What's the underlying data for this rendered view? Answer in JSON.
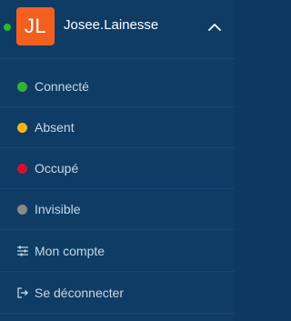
{
  "user": {
    "initials": "JL",
    "name": "Josee.Lainesse",
    "presence_color": "#2db82d",
    "avatar_color": "#f2601f"
  },
  "header": {
    "toggle_icon": "chevron-up-icon"
  },
  "status_menu": [
    {
      "label": "Connecté",
      "color": "#33b233",
      "icon": "status-dot-online"
    },
    {
      "label": "Absent",
      "color": "#f5b517",
      "icon": "status-dot-away"
    },
    {
      "label": "Occupé",
      "color": "#d2122e",
      "icon": "status-dot-busy"
    },
    {
      "label": "Invisible",
      "color": "#8a8a8a",
      "icon": "status-dot-invisible"
    }
  ],
  "account_menu": [
    {
      "label": "Mon compte",
      "icon": "sliders-icon"
    },
    {
      "label": "Se déconnecter",
      "icon": "sign-out-icon"
    }
  ],
  "colors": {
    "background": "#0f3c64",
    "divider": "#174670",
    "text": "#c6d7e9"
  }
}
